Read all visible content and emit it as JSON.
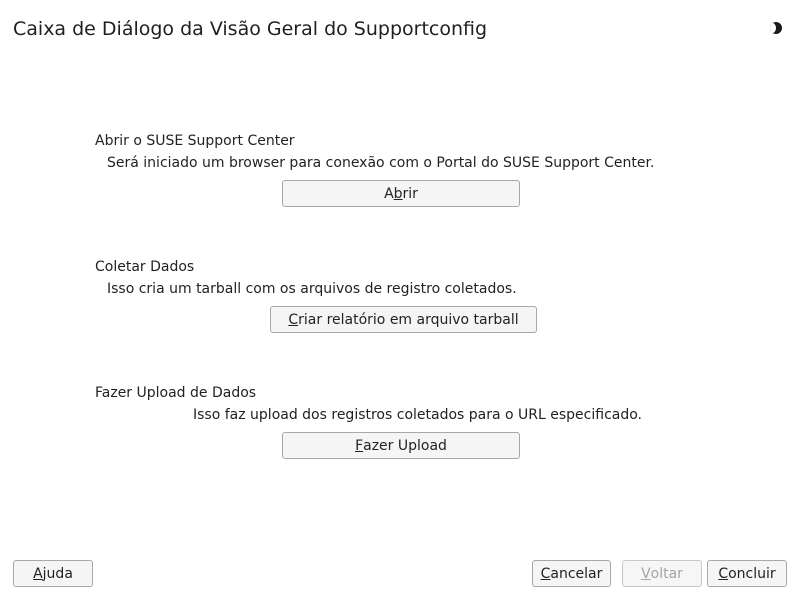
{
  "window": {
    "title": "Caixa de Diálogo da Visão Geral do Supportconfig",
    "theme_icon": "half-moon-icon"
  },
  "sections": [
    {
      "label": "Abrir o SUSE Support Center",
      "description": "Será iniciado um browser para conexão com o Portal do SUSE Support Center.",
      "button": {
        "pre": "A",
        "mnemonic": "b",
        "post": "rir"
      }
    },
    {
      "label": "Coletar Dados",
      "description": "Isso cria um tarball com os arquivos de registro coletados.",
      "button": {
        "pre": "",
        "mnemonic": "C",
        "post": "riar relatório em arquivo tarball"
      }
    },
    {
      "label": "Fazer Upload de Dados",
      "description": "Isso faz upload dos registros coletados para o URL especificado.",
      "button": {
        "pre": "",
        "mnemonic": "F",
        "post": "azer Upload"
      }
    }
  ],
  "footer": {
    "help": {
      "pre": "",
      "mnemonic": "A",
      "post": "juda"
    },
    "cancel": {
      "pre": "",
      "mnemonic": "C",
      "post": "ancelar"
    },
    "back": {
      "pre": "",
      "mnemonic": "V",
      "post": "oltar",
      "enabled": false
    },
    "finish": {
      "pre": "",
      "mnemonic": "C",
      "post": "oncluir"
    }
  },
  "colors": {
    "background": "#ffffff",
    "button_bg": "#f5f5f5",
    "button_border": "#a8a8a8",
    "disabled_text": "#a4a4a4"
  }
}
